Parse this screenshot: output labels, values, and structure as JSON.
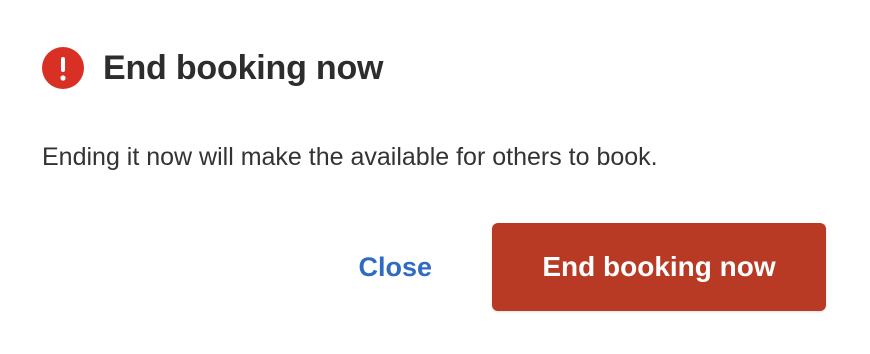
{
  "dialog": {
    "icon": "exclamation-alert-icon",
    "title": "End booking now",
    "message": "Ending it now will make the available for others to book.",
    "close_label": "Close",
    "confirm_label": "End booking now"
  },
  "colors": {
    "alert": "#d93025",
    "link": "#2f6bc2",
    "primary": "#b83a24"
  }
}
